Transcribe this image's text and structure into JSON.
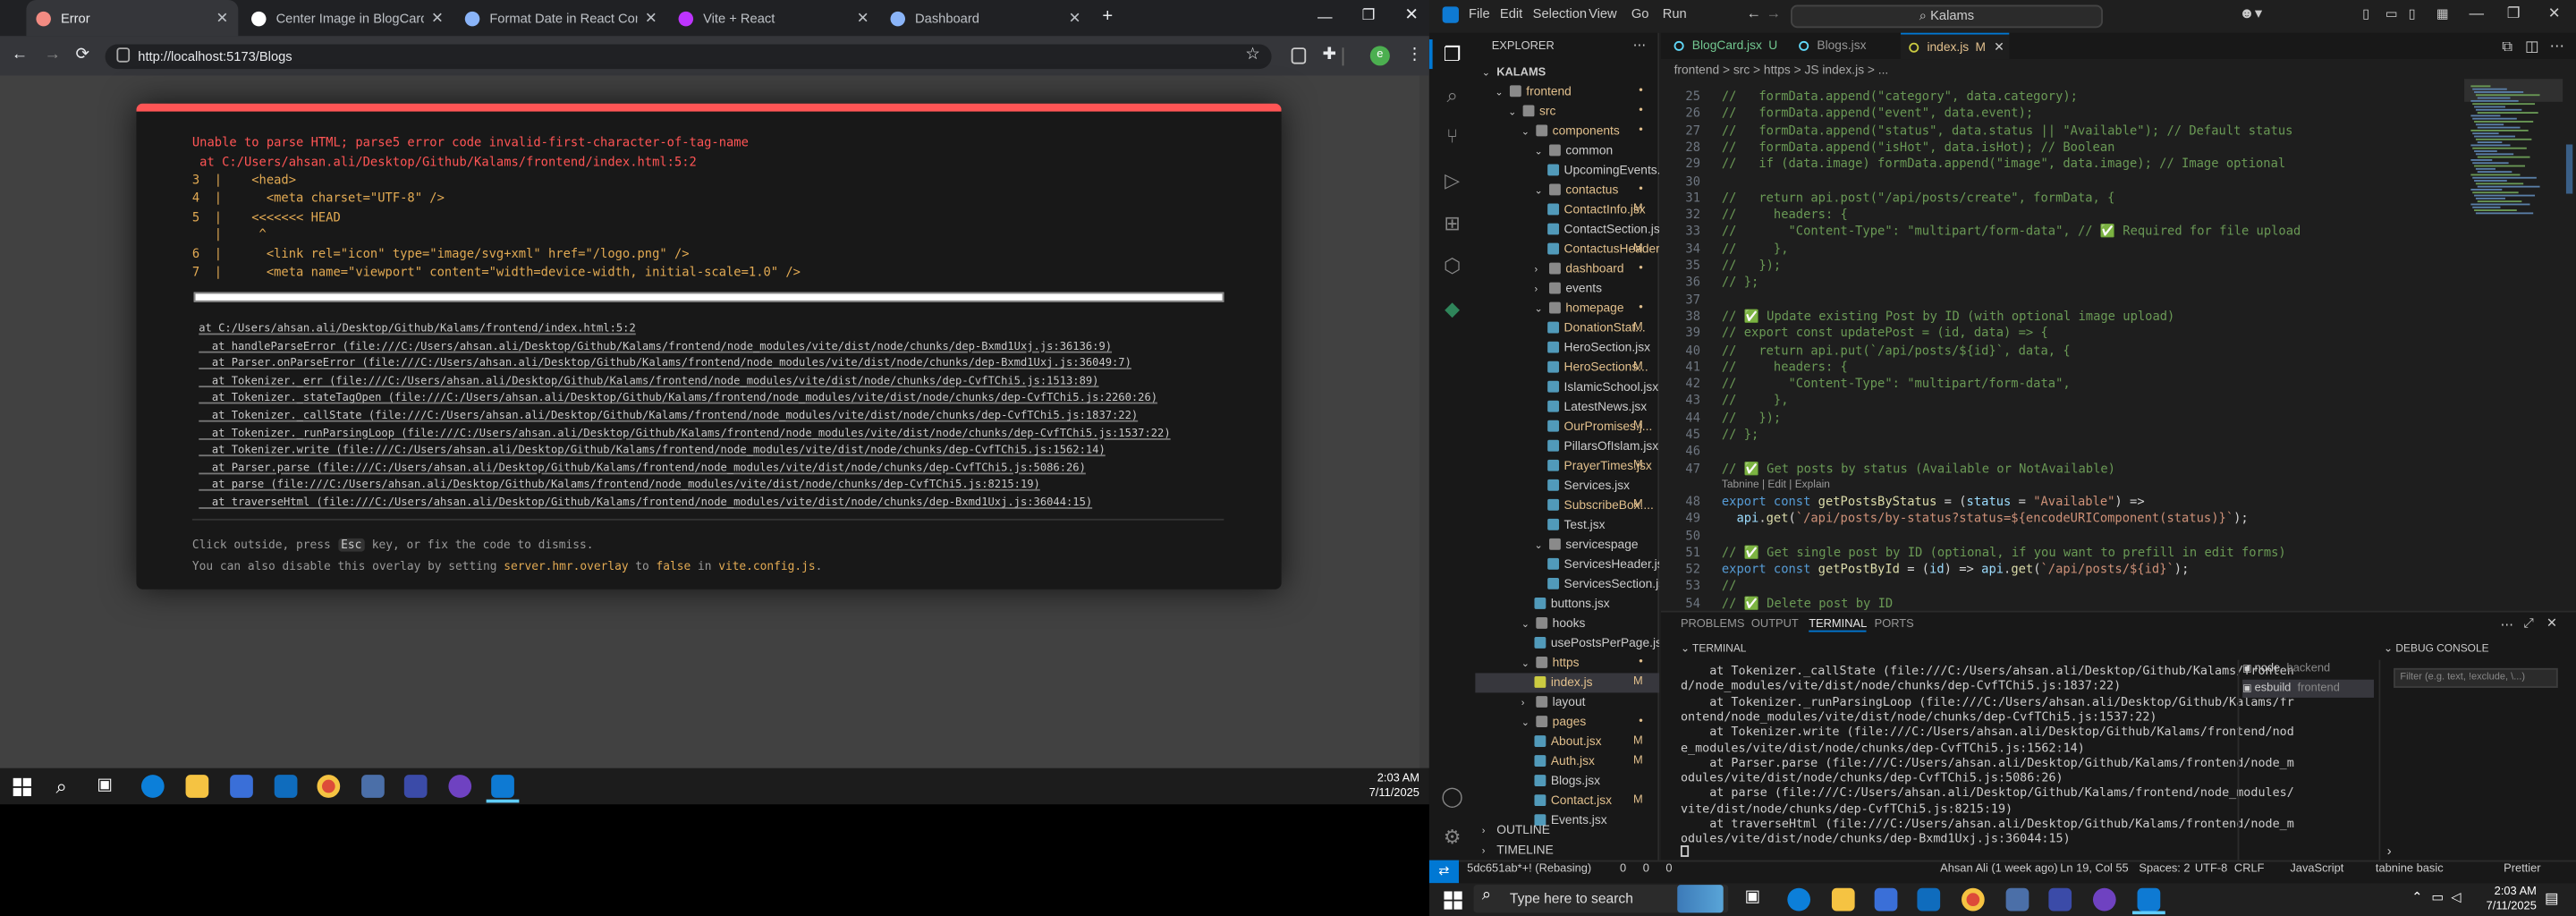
{
  "chrome": {
    "tabs": [
      {
        "title": "Error",
        "color": "#f28b82"
      },
      {
        "title": "Center Image in BlogCard",
        "color": "#ffffff"
      },
      {
        "title": "Format Date in React Compone",
        "color": "#8ab4f8"
      },
      {
        "title": "Vite + React",
        "color": "#bd34fe"
      },
      {
        "title": "Dashboard",
        "color": "#8ab4f8"
      }
    ],
    "new_tab": "+",
    "url": "http://localhost:5173/Blogs"
  },
  "overlay": {
    "lines": [
      "Unable to parse HTML; parse5 error code invalid-first-character-of-tag-name",
      " at C:/Users/ahsan.ali/Desktop/Github/Kalams/frontend/index.html:5:2",
      "3  |    <head>",
      "4  |      <meta charset=\"UTF-8\" />",
      "5  |    <<<<<<< HEAD",
      "   |     ^",
      "6  |      <link rel=\"icon\" type=\"image/svg+xml\" href=\"/logo.png\" />",
      "7  |      <meta name=\"viewport\" content=\"width=device-width, initial-scale=1.0\" />"
    ],
    "stack": [
      "at C:/Users/ahsan.ali/Desktop/Github/Kalams/frontend/index.html:5:2",
      "  at handleParseError (file:///C:/Users/ahsan.ali/Desktop/Github/Kalams/frontend/node_modules/vite/dist/node/chunks/dep-Bxmd1Uxj.js:36136:9)",
      "  at Parser.onParseError (file:///C:/Users/ahsan.ali/Desktop/Github/Kalams/frontend/node_modules/vite/dist/node/chunks/dep-Bxmd1Uxj.js:36049:7)",
      "  at Tokenizer._err (file:///C:/Users/ahsan.ali/Desktop/Github/Kalams/frontend/node_modules/vite/dist/node/chunks/dep-CvfTChi5.js:1513:89)",
      "  at Tokenizer._stateTagOpen (file:///C:/Users/ahsan.ali/Desktop/Github/Kalams/frontend/node_modules/vite/dist/node/chunks/dep-CvfTChi5.js:2260:26)",
      "  at Tokenizer._callState (file:///C:/Users/ahsan.ali/Desktop/Github/Kalams/frontend/node_modules/vite/dist/node/chunks/dep-CvfTChi5.js:1837:22)",
      "  at Tokenizer._runParsingLoop (file:///C:/Users/ahsan.ali/Desktop/Github/Kalams/frontend/node_modules/vite/dist/node/chunks/dep-CvfTChi5.js:1537:22)",
      "  at Tokenizer.write (file:///C:/Users/ahsan.ali/Desktop/Github/Kalams/frontend/node_modules/vite/dist/node/chunks/dep-CvfTChi5.js:1562:14)",
      "  at Parser.parse (file:///C:/Users/ahsan.ali/Desktop/Github/Kalams/frontend/node_modules/vite/dist/node/chunks/dep-CvfTChi5.js:5086:26)",
      "  at parse (file:///C:/Users/ahsan.ali/Desktop/Github/Kalams/frontend/node_modules/vite/dist/node/chunks/dep-CvfTChi5.js:8215:19)",
      "  at traverseHtml (file:///C:/Users/ahsan.ali/Desktop/Github/Kalams/frontend/node_modules/vite/dist/node/chunks/dep-Bxmd1Uxj.js:36044:15)"
    ],
    "tip1_a": "Click outside, press ",
    "tip1_key": "Esc",
    "tip1_b": " key, or fix the code to dismiss.",
    "tip2_a": "You can also disable this overlay by setting ",
    "tip2_hl": "server.hmr.overlay",
    "tip2_b": " to ",
    "tip2_hl2": "false",
    "tip2_c": " in ",
    "tip2_hl3": "vite.config.js",
    "tip2_d": "."
  },
  "taskbar_left": {
    "time": "2:03 AM",
    "date": "7/11/2025"
  },
  "vscode": {
    "menu": [
      "File",
      "Edit",
      "Selection",
      "View",
      "Go",
      "Run"
    ],
    "search": "Kalams",
    "explorer_title": "EXPLORER",
    "tree": [
      {
        "label": "KALAMS",
        "depth": 0,
        "arrow": "v",
        "type": "root"
      },
      {
        "label": "frontend",
        "depth": 1,
        "arrow": "v",
        "type": "folder",
        "badge": "•"
      },
      {
        "label": "src",
        "depth": 2,
        "arrow": "v",
        "type": "folder",
        "badge": "•"
      },
      {
        "label": "components",
        "depth": 3,
        "arrow": "v",
        "type": "folder",
        "badge": "•"
      },
      {
        "label": "common",
        "depth": 4,
        "arrow": "v",
        "type": "folder"
      },
      {
        "label": "UpcomingEvents.jsx",
        "depth": 5,
        "type": "file"
      },
      {
        "label": "contactus",
        "depth": 4,
        "arrow": "v",
        "type": "folder",
        "badge": "•"
      },
      {
        "label": "ContactInfo.jsx",
        "depth": 5,
        "type": "file",
        "badge": "M"
      },
      {
        "label": "ContactSection.jsx",
        "depth": 5,
        "type": "file"
      },
      {
        "label": "ContactusHeader.jsx",
        "depth": 5,
        "type": "file",
        "badge": "M"
      },
      {
        "label": "dashboard",
        "depth": 4,
        "arrow": ">",
        "type": "folder",
        "badge": "•"
      },
      {
        "label": "events",
        "depth": 4,
        "arrow": ">",
        "type": "folder"
      },
      {
        "label": "homepage",
        "depth": 4,
        "arrow": "v",
        "type": "folder",
        "badge": "•"
      },
      {
        "label": "DonationStat...",
        "depth": 5,
        "type": "file",
        "badge": "M"
      },
      {
        "label": "HeroSection.jsx",
        "depth": 5,
        "type": "file"
      },
      {
        "label": "HeroSections...",
        "depth": 5,
        "type": "file",
        "badge": "M"
      },
      {
        "label": "IslamicSchool.jsx",
        "depth": 5,
        "type": "file"
      },
      {
        "label": "LatestNews.jsx",
        "depth": 5,
        "type": "file"
      },
      {
        "label": "OurPromises.j...",
        "depth": 5,
        "type": "file",
        "badge": "M"
      },
      {
        "label": "PillarsOfIslam.jsx",
        "depth": 5,
        "type": "file"
      },
      {
        "label": "PrayerTimes.jsx",
        "depth": 5,
        "type": "file",
        "badge": "M"
      },
      {
        "label": "Services.jsx",
        "depth": 5,
        "type": "file"
      },
      {
        "label": "SubscribeBox....",
        "depth": 5,
        "type": "file",
        "badge": "M"
      },
      {
        "label": "Test.jsx",
        "depth": 5,
        "type": "file"
      },
      {
        "label": "servicespage",
        "depth": 4,
        "arrow": "v",
        "type": "folder"
      },
      {
        "label": "ServicesHeader.jsx",
        "depth": 5,
        "type": "file"
      },
      {
        "label": "ServicesSection.jsx",
        "depth": 5,
        "type": "file"
      },
      {
        "label": "buttons.jsx",
        "depth": 4,
        "type": "file"
      },
      {
        "label": "hooks",
        "depth": 3,
        "arrow": "v",
        "type": "folder"
      },
      {
        "label": "usePostsPerPage.jsx",
        "depth": 4,
        "type": "file"
      },
      {
        "label": "https",
        "depth": 3,
        "arrow": "v",
        "type": "folder",
        "badge": "•"
      },
      {
        "label": "index.js",
        "depth": 4,
        "type": "file",
        "badge": "M",
        "selected": true
      },
      {
        "label": "layout",
        "depth": 3,
        "arrow": ">",
        "type": "folder"
      },
      {
        "label": "pages",
        "depth": 3,
        "arrow": "v",
        "type": "folder",
        "badge": "•"
      },
      {
        "label": "About.jsx",
        "depth": 4,
        "type": "file",
        "badge": "M"
      },
      {
        "label": "Auth.jsx",
        "depth": 4,
        "type": "file",
        "badge": "M"
      },
      {
        "label": "Blogs.jsx",
        "depth": 4,
        "type": "file"
      },
      {
        "label": "Contact.jsx",
        "depth": 4,
        "type": "file",
        "badge": "M"
      },
      {
        "label": "Events.jsx",
        "depth": 4,
        "type": "file"
      }
    ],
    "outline": "OUTLINE",
    "timeline": "TIMELINE",
    "editor_tabs": [
      {
        "label": "BlogCard.jsx",
        "badge": "U"
      },
      {
        "label": "Blogs.jsx",
        "badge": ""
      },
      {
        "label": "index.js",
        "badge": "M"
      }
    ],
    "breadcrumb": "frontend > src > https > JS index.js > ...",
    "code": [
      {
        "n": "25",
        "t": "//   formData.append(\"category\", data.category);",
        "c": "cm"
      },
      {
        "n": "26",
        "t": "//   formData.append(\"event\", data.event);",
        "c": "cm"
      },
      {
        "n": "27",
        "t": "//   formData.append(\"status\", data.status || \"Available\"); // Default status",
        "c": "cm"
      },
      {
        "n": "28",
        "t": "//   formData.append(\"isHot\", data.isHot); // Boolean",
        "c": "cm"
      },
      {
        "n": "29",
        "t": "//   if (data.image) formData.append(\"image\", data.image); // Image optional",
        "c": "cm"
      },
      {
        "n": "30",
        "t": "",
        "c": ""
      },
      {
        "n": "31",
        "t": "//   return api.post(\"/api/posts/create\", formData, {",
        "c": "cm"
      },
      {
        "n": "32",
        "t": "//     headers: {",
        "c": "cm"
      },
      {
        "n": "33",
        "t": "//       \"Content-Type\": \"multipart/form-data\", // ✅ Required for file upload",
        "c": "cm"
      },
      {
        "n": "34",
        "t": "//     },",
        "c": "cm"
      },
      {
        "n": "35",
        "t": "//   });",
        "c": "cm"
      },
      {
        "n": "36",
        "t": "// };",
        "c": "cm"
      },
      {
        "n": "37",
        "t": "",
        "c": ""
      },
      {
        "n": "38",
        "t": "// ✅ Update existing Post by ID (with optional image upload)",
        "c": "cm"
      },
      {
        "n": "39",
        "t": "// export const updatePost = (id, data) => {",
        "c": "cm"
      },
      {
        "n": "40",
        "t": "//   return api.put(`/api/posts/${id}`, data, {",
        "c": "cm"
      },
      {
        "n": "41",
        "t": "//     headers: {",
        "c": "cm"
      },
      {
        "n": "42",
        "t": "//       \"Content-Type\": \"multipart/form-data\",",
        "c": "cm"
      },
      {
        "n": "43",
        "t": "//     },",
        "c": "cm"
      },
      {
        "n": "44",
        "t": "//   });",
        "c": "cm"
      },
      {
        "n": "45",
        "t": "// };",
        "c": "cm"
      },
      {
        "n": "46",
        "t": "",
        "c": ""
      },
      {
        "n": "47",
        "t": "// ✅ Get posts by status (Available or NotAvailable)",
        "c": "cm"
      },
      {
        "n": "48",
        "t": "export const getPostsByStatus = (status = \"Available\") =>",
        "c": "code"
      },
      {
        "n": "49",
        "t": "  api.get(`/api/posts/by-status?status=${encodeURIComponent(status)}`);",
        "c": "code"
      },
      {
        "n": "50",
        "t": "",
        "c": ""
      },
      {
        "n": "51",
        "t": "// ✅ Get single post by ID (optional, if you want to prefill in edit forms)",
        "c": "cm"
      },
      {
        "n": "52",
        "t": "export const getPostById = (id) => api.get(`/api/posts/${id}`);",
        "c": "code"
      },
      {
        "n": "53",
        "t": "//",
        "c": "cm"
      },
      {
        "n": "54",
        "t": "// ✅ Delete post by ID",
        "c": "cm"
      }
    ],
    "codelens": "Tabnine | Edit | Explain",
    "panel_tabs": [
      "PROBLEMS",
      "OUTPUT",
      "TERMINAL",
      "PORTS"
    ],
    "terminal_title": "TERMINAL",
    "terminal_lines": [
      "    at Tokenizer._callState (file:///C:/Users/ahsan.ali/Desktop/Github/Kalams/fronten",
      "d/node_modules/vite/dist/node/chunks/dep-CvfTChi5.js:1837:22)",
      "    at Tokenizer._runParsingLoop (file:///C:/Users/ahsan.ali/Desktop/Github/Kalams/fr",
      "ontend/node_modules/vite/dist/node/chunks/dep-CvfTChi5.js:1537:22)",
      "    at Tokenizer.write (file:///C:/Users/ahsan.ali/Desktop/Github/Kalams/frontend/nod",
      "e_modules/vite/dist/node/chunks/dep-CvfTChi5.js:1562:14)",
      "    at Parser.parse (file:///C:/Users/ahsan.ali/Desktop/Github/Kalams/frontend/node_m",
      "odules/vite/dist/node/chunks/dep-CvfTChi5.js:5086:26)",
      "    at parse (file:///C:/Users/ahsan.ali/Desktop/Github/Kalams/frontend/node_modules/",
      "vite/dist/node/chunks/dep-CvfTChi5.js:8215:19)",
      "    at traverseHtml (file:///C:/Users/ahsan.ali/Desktop/Github/Kalams/frontend/node_m",
      "odules/vite/dist/node/chunks/dep-Bxmd1Uxj.js:36044:15)"
    ],
    "terminals": [
      {
        "name": "node",
        "folder": "backend"
      },
      {
        "name": "esbuild",
        "folder": "frontend"
      }
    ],
    "debug_title": "DEBUG CONSOLE",
    "debug_filter": "Filter (e.g. text, !exclude, \\...)",
    "status": {
      "branch": "5dc651ab*+! (Rebasing)",
      "errors": "0",
      "warnings": "0",
      "ports": "0",
      "author": "Ahsan Ali (1 week ago)",
      "pos": "Ln 19, Col 55",
      "spaces": "Spaces: 2",
      "enc": "UTF-8",
      "eol": "CRLF",
      "lang": "JavaScript",
      "tabnine": "tabnine basic",
      "prettier": "Prettier"
    }
  },
  "taskbar_right": {
    "search_placeholder": "Type here to search",
    "time": "2:03 AM",
    "date": "7/11/2025"
  }
}
